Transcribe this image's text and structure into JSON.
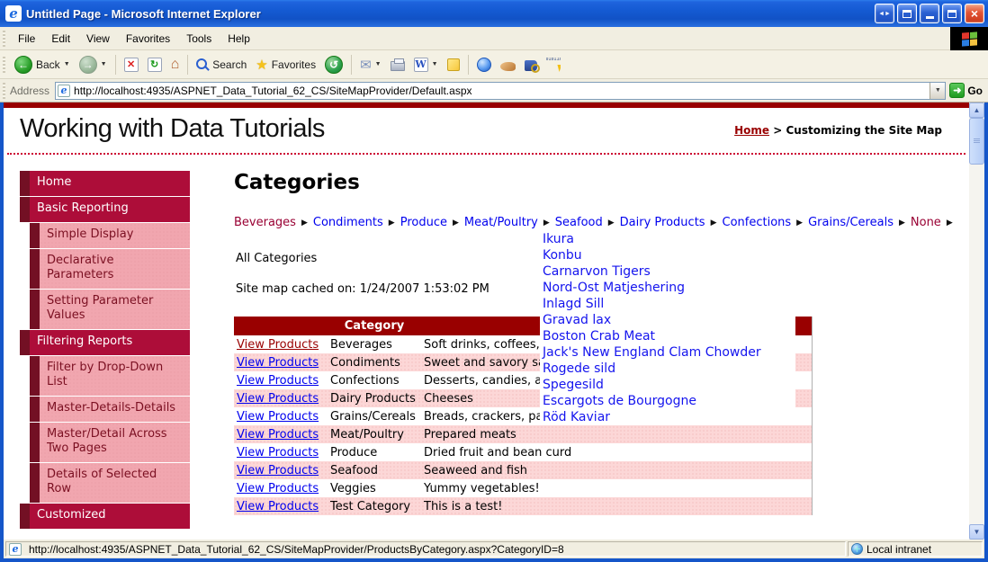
{
  "window": {
    "title": "Untitled Page - Microsoft Internet Explorer"
  },
  "menu_bar": {
    "items": [
      "File",
      "Edit",
      "View",
      "Favorites",
      "Tools",
      "Help"
    ]
  },
  "toolbar": {
    "back_label": "Back",
    "search_label": "Search",
    "favorites_label": "Favorites"
  },
  "address_bar": {
    "label": "Address",
    "url": "http://localhost:4935/ASPNET_Data_Tutorial_62_CS/SiteMapProvider/Default.aspx",
    "go_label": "Go"
  },
  "icons": {
    "back": "←",
    "forward": "→",
    "stop": "✕",
    "refresh": "↻",
    "home": "⌂",
    "favorites_star": "★",
    "history": "↺",
    "mail": "✉",
    "word": "W",
    "dropdown_caret": "▼",
    "menu_arrow": "▶",
    "scroll_up": "▲",
    "scroll_down": "▼",
    "go_arrow": "➜",
    "close": "×",
    "binary": "010110100101"
  },
  "page": {
    "site_title": "Working with Data Tutorials",
    "breadcrumb": {
      "home": "Home",
      "separator": ">",
      "current": "Customizing the Site Map"
    },
    "sidebar": {
      "items": [
        {
          "label": "Home",
          "level": 0
        },
        {
          "label": "Basic Reporting",
          "level": 0
        },
        {
          "label": "Simple Display",
          "level": 1
        },
        {
          "label": "Declarative Parameters",
          "level": 1
        },
        {
          "label": "Setting Parameter Values",
          "level": 1
        },
        {
          "label": "Filtering Reports",
          "level": 0
        },
        {
          "label": "Filter by Drop-Down List",
          "level": 1
        },
        {
          "label": "Master-Details-Details",
          "level": 1
        },
        {
          "label": "Master/Detail Across Two Pages",
          "level": 1
        },
        {
          "label": "Details of Selected Row",
          "level": 1
        },
        {
          "label": "Customized",
          "level": 0
        }
      ]
    },
    "main": {
      "heading": "Categories",
      "category_menu": {
        "items": [
          {
            "label": "Beverages",
            "selected": true
          },
          {
            "label": "Condiments",
            "selected": false
          },
          {
            "label": "Produce",
            "selected": false
          },
          {
            "label": "Meat/Poultry",
            "selected": false
          },
          {
            "label": "Seafood",
            "selected": false
          },
          {
            "label": "Dairy Products",
            "selected": false
          },
          {
            "label": "Confections",
            "selected": false
          },
          {
            "label": "Grains/Cereals",
            "selected": false
          },
          {
            "label": "None",
            "selected": true
          }
        ]
      },
      "all_categories_label": "All Categories",
      "cache_note": "Site map cached on: 1/24/2007 1:53:02 PM",
      "table": {
        "link_label": "View Products",
        "category_header": "Category",
        "rows": [
          {
            "category": "Beverages",
            "description": "Soft drinks, coffees, teas, beers, and ales",
            "visited": true
          },
          {
            "category": "Condiments",
            "description": "Sweet and savory sauces, relishes, spreads, and seasonings",
            "visited": false
          },
          {
            "category": "Confections",
            "description": "Desserts, candies, and sweet breads",
            "visited": false
          },
          {
            "category": "Dairy Products",
            "description": "Cheeses",
            "visited": false
          },
          {
            "category": "Grains/Cereals",
            "description": "Breads, crackers, pasta, and cereal",
            "visited": false
          },
          {
            "category": "Meat/Poultry",
            "description": "Prepared meats",
            "visited": false
          },
          {
            "category": "Produce",
            "description": "Dried fruit and bean curd",
            "visited": false
          },
          {
            "category": "Seafood",
            "description": "Seaweed and fish",
            "visited": false
          },
          {
            "category": "Veggies",
            "description": "Yummy vegetables!",
            "visited": false
          },
          {
            "category": "Test Category",
            "description": "This is a test!",
            "visited": false
          }
        ]
      },
      "product_menu": {
        "items": [
          "Ikura",
          "Konbu",
          "Carnarvon Tigers",
          "Nord-Ost Matjeshering",
          "Inlagd Sill",
          "Gravad lax",
          "Boston Crab Meat",
          "Jack's New England Clam Chowder",
          "Rogede sild",
          "Spegesild",
          "Escargots de Bourgogne",
          "Röd Kaviar"
        ]
      }
    }
  },
  "status_bar": {
    "url": "http://localhost:4935/ASPNET_Data_Tutorial_62_CS/SiteMapProvider/ProductsByCategory.aspx?CategoryID=8",
    "zone": "Local intranet"
  },
  "colors": {
    "accent_dark_red": "#990000",
    "sidebar_top_bg": "#ad0d39",
    "sidebar_strip": "#731024",
    "sidebar_sub_bg": "#f1a6af",
    "sidebar_sub_text": "#7b1022",
    "link_blue": "#0000ee",
    "visited_red": "#990000",
    "alt_row_pink": "#fcd7d7",
    "titlebar_blue": "#1556c9"
  }
}
